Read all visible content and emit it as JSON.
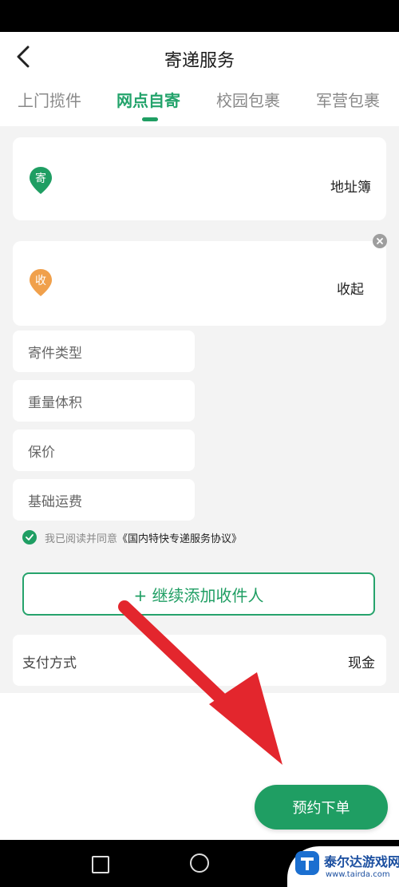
{
  "header": {
    "title": "寄递服务"
  },
  "tabs": [
    {
      "label": "上门揽件",
      "active": false
    },
    {
      "label": "网点自寄",
      "active": true
    },
    {
      "label": "校园包裹",
      "active": false
    },
    {
      "label": "军营包裹",
      "active": false
    }
  ],
  "sender": {
    "badge": "寄",
    "action": "地址簿",
    "icon": "sender-pin-icon"
  },
  "receiver": {
    "badge": "收",
    "action": "收起",
    "icon": "receiver-pin-icon"
  },
  "fields": [
    {
      "label": "寄件类型"
    },
    {
      "label": "重量体积"
    },
    {
      "label": "保价"
    },
    {
      "label": "基础运费"
    }
  ],
  "agreement": {
    "prefix": "我已阅读并同意",
    "link": "《国内特快专递服务协议》",
    "checked": true
  },
  "add_receiver": {
    "label": "+ 继续添加收件人"
  },
  "payment": {
    "label": "支付方式",
    "value": "现金"
  },
  "order_button": {
    "label": "预约下单"
  },
  "watermark": {
    "title": "泰尔达游戏网",
    "url": "www.tairda.com"
  },
  "colors": {
    "accent": "#1f9e63",
    "sender_pin": "#1f9e63",
    "receiver_pin": "#f0a04b",
    "arrow": "#e3262d"
  }
}
